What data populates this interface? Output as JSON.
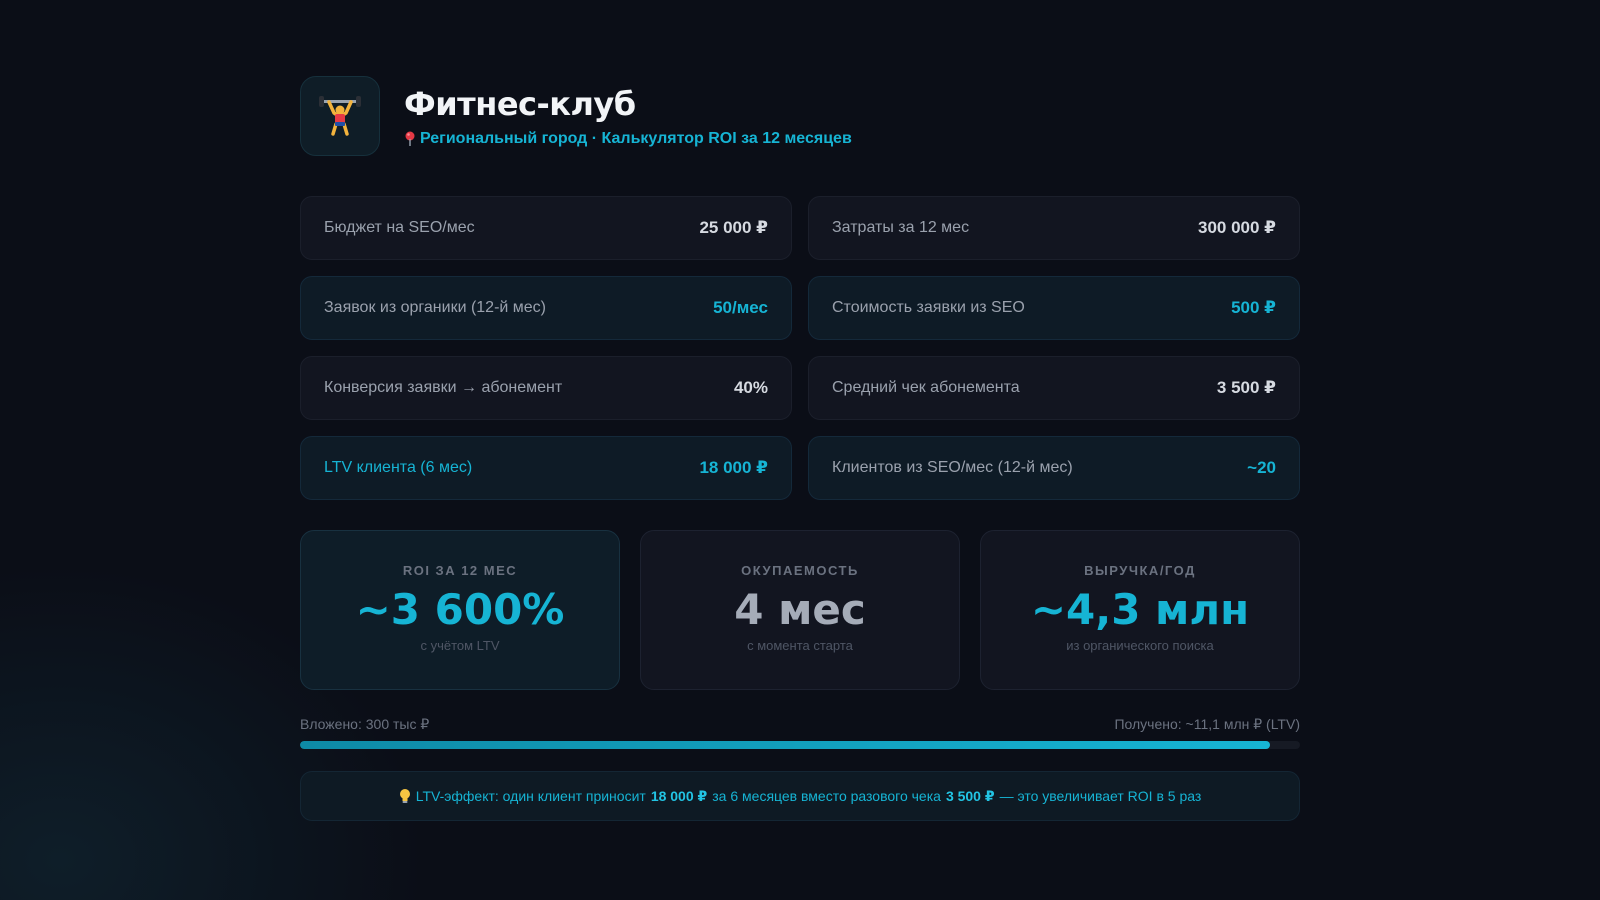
{
  "header": {
    "title": "Фитнес-клуб",
    "subtitle": "Региональный город · Калькулятор ROI за 12 месяцев",
    "logo_icon": "weightlifter-icon",
    "pin_icon": "pin-icon"
  },
  "metrics": [
    {
      "label": "Бюджет на SEO/мес",
      "value": "25 000 ₽"
    },
    {
      "label": "Затраты за 12 мес",
      "value": "300 000 ₽"
    },
    {
      "label": "Заявок из органики (12-й мес)",
      "value": "50/мес"
    },
    {
      "label": "Стоимость заявки из SEO",
      "value": "500 ₽"
    },
    {
      "label": "Конверсия заявки → абонемент",
      "value": "40%"
    },
    {
      "label": "Средний чек абонемента",
      "value": "3 500 ₽"
    },
    {
      "label": "LTV клиента (6 мес)",
      "value": "18 000 ₽"
    },
    {
      "label": "Клиентов из SEO/мес (12-й мес)",
      "value": "~20"
    }
  ],
  "cards": [
    {
      "label": "ROI ЗА 12 МЕС",
      "value": "~3 600%",
      "sub": "с учётом LTV"
    },
    {
      "label": "ОКУПАЕМОСТЬ",
      "value": "4 мес",
      "sub": "с момента старта"
    },
    {
      "label": "ВЫРУЧКА/ГОД",
      "value": "~4,3 млн",
      "sub": "из органического поиска"
    }
  ],
  "progress": {
    "left_label": "Вложено: 300 тыс ₽",
    "right_label": "Получено: ~11,1 млн ₽ (LTV)",
    "fill_fraction": 0.97
  },
  "note": {
    "icon": "lightbulb-icon",
    "part1": "LTV-эффект: один клиент приносит",
    "bold1": "18 000 ₽",
    "part2": "за 6 месяцев вместо разового чека",
    "bold2": "3 500 ₽",
    "part3": "— это увеличивает ROI в 5 раз"
  },
  "colors": {
    "accent": "#16b4d4",
    "background": "#0b0e17"
  }
}
